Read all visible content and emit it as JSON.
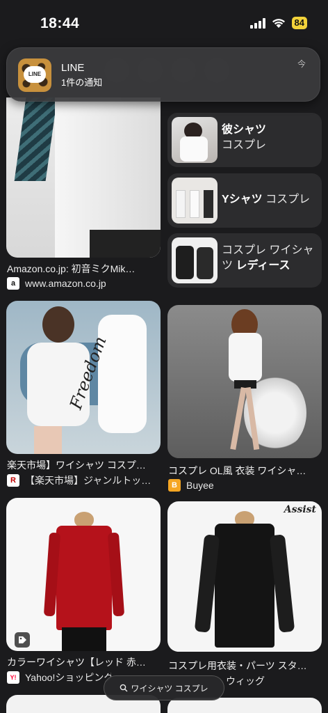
{
  "status_bar": {
    "time": "18:44",
    "battery": "84"
  },
  "notification": {
    "app": "LINE",
    "message": "1件の通知",
    "time": "今"
  },
  "results": [
    {
      "caption": "Amazon.co.jp: 初音ミクMik…",
      "source": "www.amazon.co.jp",
      "favicon": "a"
    },
    {
      "caption": "楽天市場】ワイシャツ コスプ…",
      "source": "【楽天市場】ジャンルトッ…",
      "favicon": "R"
    },
    {
      "caption": "コスプレ OL風 衣装 ワイシャ…",
      "source": "Buyee",
      "favicon": "B"
    },
    {
      "caption": "カラーワイシャツ【レッド 赤…",
      "source": "Yahoo!ショッピング",
      "favicon": "Y!"
    },
    {
      "caption": "コスプレ用衣装・パーツ スタ…",
      "source": "ウィッグ",
      "favicon": ""
    }
  ],
  "related": [
    {
      "bold": "彼シャツ",
      "rest": "コスプレ"
    },
    {
      "bold": "Yシャツ",
      "rest": "コスプレ"
    },
    {
      "prefix": "コスプレ ワイシャツ",
      "bold": "レディース"
    }
  ],
  "image_text": {
    "freedom": "Freedom",
    "assist": "Assist"
  },
  "search_pill": {
    "label": "ワイシャツ コスプレ"
  },
  "colors": {
    "background": "#1b1b1d",
    "card": "#2c2c2e",
    "battery": "#f2d23a"
  }
}
